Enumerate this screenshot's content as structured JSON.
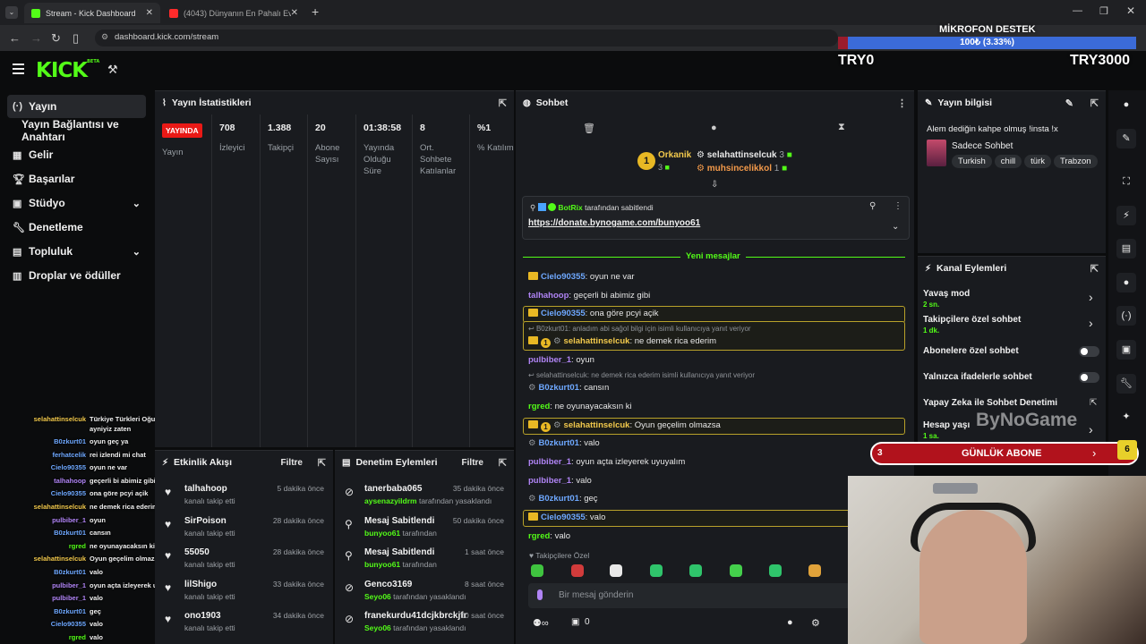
{
  "browser": {
    "tabs": [
      {
        "label": "Stream - Kick Dashboard",
        "active": true
      },
      {
        "label": "(4043) Dünyanın En Pahalı Evi / ...",
        "active": false
      }
    ],
    "url": "dashboard.kick.com/stream"
  },
  "brand": {
    "logo": "KICK",
    "beta": "BETA",
    "accent": "#53fc18"
  },
  "sidebar": {
    "items": [
      {
        "label": "Yayın",
        "icon": "broadcast-icon",
        "active": true
      },
      {
        "label": "Yayın Bağlantısı ve Anahtarı",
        "icon": ""
      },
      {
        "label": "Gelir",
        "icon": "money-icon"
      },
      {
        "label": "Başarılar",
        "icon": "trophy-icon"
      },
      {
        "label": "Stüdyo",
        "icon": "studio-icon",
        "chevron": true
      },
      {
        "label": "Denetleme",
        "icon": "wrench-icon"
      },
      {
        "label": "Topluluk",
        "icon": "community-icon",
        "chevron": true
      },
      {
        "label": "Droplar ve ödüller",
        "icon": "gift-icon"
      }
    ]
  },
  "stats": {
    "title": "Yayın İstatistikleri",
    "live_badge": "YAYINDA",
    "live_label": "Yayın",
    "items": [
      {
        "value": "708",
        "label": "İzleyici"
      },
      {
        "value": "1.388",
        "label": "Takipçi"
      },
      {
        "value": "20",
        "label": "Abone Sayısı"
      },
      {
        "value": "01:38:58",
        "label": "Yayında Olduğu Süre"
      },
      {
        "value": "8",
        "label": "Ort. Sohbete Katılanlar"
      },
      {
        "value": "%1",
        "label": "% Katılım"
      }
    ]
  },
  "activity": {
    "title": "Etkinlik Akışı",
    "filter": "Filtre",
    "items": [
      {
        "name": "talhahoop",
        "sub": "kanalı takip etti",
        "time": "5 dakika önce"
      },
      {
        "name": "SirPoison",
        "sub": "kanalı takip etti",
        "time": "28 dakika önce"
      },
      {
        "name": "55050",
        "sub": "kanalı takip etti",
        "time": "28 dakika önce"
      },
      {
        "name": "lilShigo",
        "sub": "kanalı takip etti",
        "time": "33 dakika önce"
      },
      {
        "name": "ono1903",
        "sub": "kanalı takip etti",
        "time": "34 dakika önce"
      }
    ]
  },
  "moderation": {
    "title": "Denetim Eylemleri",
    "filter": "Filtre",
    "items": [
      {
        "name": "tanerbaba065",
        "by": "aysenazyildrm",
        "sub": "tarafından yasaklandı",
        "time": "35 dakika önce",
        "icon": "ban-icon"
      },
      {
        "name": "Mesaj Sabitlendi",
        "by": "bunyoo61",
        "sub": "tarafından",
        "time": "50 dakika önce",
        "icon": "pin-icon"
      },
      {
        "name": "Mesaj Sabitlendi",
        "by": "bunyoo61",
        "sub": "tarafından",
        "time": "1 saat önce",
        "icon": "pin-icon"
      },
      {
        "name": "Genco3169",
        "by": "Seyo06",
        "sub": "tarafından yasaklandı",
        "time": "8 saat önce",
        "icon": "ban-icon"
      },
      {
        "name": "franekurdu41dcjkbrckjfr",
        "by": "Seyo06",
        "sub": "tarafından yasaklandı",
        "time": "10 saat önce",
        "icon": "ban-icon"
      }
    ]
  },
  "chat": {
    "title": "Sohbet",
    "top": [
      {
        "name": "Orkanik",
        "count": "3",
        "rank": "1"
      },
      {
        "name": "selahattinselcuk",
        "count": "3"
      },
      {
        "name": "muhsincelikkol",
        "count": "1"
      }
    ],
    "pinned": {
      "by": "BotRix",
      "by_suffix": "tarafından sabitlendi",
      "link": "https://donate.bynogame.com/bunyoo61"
    },
    "new_messages": "Yeni mesajlar",
    "messages": [
      {
        "user": "Cielo90355",
        "text": ": oyun ne var",
        "color": "blue",
        "crown": true
      },
      {
        "user": "talhahoop",
        "text": ": geçerli bi abimiz gibi",
        "color": "purple"
      },
      {
        "user": "Cielo90355",
        "text": ": ona göre pcyi açik",
        "color": "blue",
        "crown": true,
        "highlight": true
      },
      {
        "reply": "B0zkurt01: anladım abi sağol bilgi için isimli kullanıcıya yanıt veriyor",
        "user": "selahattinselcuk",
        "text": ": ne demek rica ederim",
        "color": "gold",
        "highlight": true
      },
      {
        "user": "pulbiber_1",
        "text": ": oyun",
        "color": "purple"
      },
      {
        "reply": "selahattinselcuk: ne demek rica ederim isimli kullanıcıya yanıt veriyor",
        "user": "B0zkurt01",
        "text": ": cansın",
        "color": "blue"
      },
      {
        "user": "rgred",
        "text": ": ne oyunayacaksın ki",
        "color": "green"
      },
      {
        "user": "selahattinselcuk",
        "text": ": Oyun geçelim olmazsa",
        "color": "gold",
        "highlight": true
      },
      {
        "user": "B0zkurt01",
        "text": ": valo",
        "color": "blue"
      },
      {
        "user": "pulbiber_1",
        "text": ": oyun açta izleyerek uyuyalım",
        "color": "purple"
      },
      {
        "user": "pulbiber_1",
        "text": ": valo",
        "color": "purple"
      },
      {
        "user": "B0zkurt01",
        "text": ": geç",
        "color": "blue"
      },
      {
        "user": "Cielo90355",
        "text": ": valo",
        "color": "blue",
        "crown": true,
        "highlight": true
      },
      {
        "user": "rgred",
        "text": ": valo",
        "color": "green"
      }
    ],
    "followers_only": "Takipçilere Özel",
    "input_placeholder": "Bir mesaj gönderin",
    "viewers_icon_count": "0"
  },
  "stream_info": {
    "title": "Yayın bilgisi",
    "stream_title": "Alem dediğin kahpe olmuş !insta !x",
    "category": "Sadece Sohbet",
    "tags": [
      "Turkish",
      "chill",
      "türk",
      "Trabzon"
    ]
  },
  "channel_actions": {
    "title": "Kanal Eylemleri",
    "items": [
      {
        "label": "Yavaş mod",
        "sub": "2 sn.",
        "type": "chevron"
      },
      {
        "label": "Takipçilere özel sohbet",
        "sub": "1 dk.",
        "type": "chevron"
      },
      {
        "label": "Abonelere özel sohbet",
        "type": "toggle"
      },
      {
        "label": "Yalnızca ifadelerle sohbet",
        "type": "toggle"
      },
      {
        "label": "Yapay Zeka ile Sohbet Denetimi",
        "type": "link"
      },
      {
        "label": "Hesap yaşı",
        "sub": "1 sa.",
        "type": "chevron"
      }
    ]
  },
  "overlay": {
    "donation_title": "MİKROFON DESTEK",
    "donation_progress": "100₺ (3.33%)",
    "donation_progress_value": 0.0333,
    "donation_left": "TRY0",
    "donation_right": "TRY3000",
    "watermark": "ByNoGame",
    "sub_goal": {
      "left": "3",
      "label": "GÜNLÜK ABONE",
      "right": "6"
    },
    "chat": [
      {
        "user": "selahattinselcuk",
        "text": "Türkiye Türkleri Oğuz Türkleri, Gagavuzlarda Oğuz Türkleri ondan",
        "cont": "ayniyiz zaten",
        "color": "#f2c94c"
      },
      {
        "user": "B0zkurt01",
        "text": "oyun geç ya",
        "color": "#6ea8ff"
      },
      {
        "user": "ferhatcelik",
        "text": "rei izlendi mi chat",
        "color": "#6ea8ff"
      },
      {
        "user": "Cielo90355",
        "text": "oyun ne var",
        "color": "#6ea8ff"
      },
      {
        "user": "talhahoop",
        "text": "geçerli bi abimiz gibi",
        "color": "#b084f5"
      },
      {
        "user": "Cielo90355",
        "text": "ona göre pcyi açik",
        "color": "#6ea8ff"
      },
      {
        "user": "selahattinselcuk",
        "text": "ne demek rica ederim",
        "color": "#f2c94c"
      },
      {
        "user": "pulbiber_1",
        "text": "oyun",
        "color": "#b084f5"
      },
      {
        "user": "B0zkurt01",
        "text": "cansın",
        "color": "#6ea8ff"
      },
      {
        "user": "rgred",
        "text": "ne oyunayacaksın ki",
        "color": "#53fc18"
      },
      {
        "user": "selahattinselcuk",
        "text": "Oyun geçelim olmazsa",
        "color": "#f2c94c"
      },
      {
        "user": "B0zkurt01",
        "text": "valo",
        "color": "#6ea8ff"
      },
      {
        "user": "pulbiber_1",
        "text": "oyun açta izleyerek uyuyalım",
        "color": "#b084f5"
      },
      {
        "user": "pulbiber_1",
        "text": "valo",
        "color": "#b084f5"
      },
      {
        "user": "B0zkurt01",
        "text": "geç",
        "color": "#6ea8ff"
      },
      {
        "user": "Cielo90355",
        "text": "valo",
        "color": "#6ea8ff"
      },
      {
        "user": "rgred",
        "text": "valo",
        "color": "#53fc18"
      }
    ]
  }
}
